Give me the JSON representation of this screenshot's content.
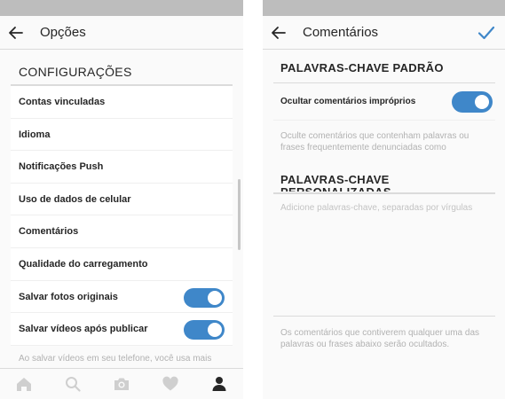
{
  "colors": {
    "accent": "#3f87c9",
    "status_bar": "#bdbdbd",
    "muted_text": "#b2b2b2"
  },
  "left_screen": {
    "title": "Opções",
    "section_header": "CONFIGURAÇÕES",
    "menu_items": [
      {
        "label": "Contas vinculadas",
        "toggle": false
      },
      {
        "label": "Idioma",
        "toggle": false
      },
      {
        "label": "Notificações Push",
        "toggle": false
      },
      {
        "label": "Uso de dados de celular",
        "toggle": false
      },
      {
        "label": "Comentários",
        "toggle": false
      },
      {
        "label": "Qualidade do carregamento",
        "toggle": false
      },
      {
        "label": "Salvar fotos originais",
        "toggle": true,
        "on": true
      },
      {
        "label": "Salvar vídeos após publicar",
        "toggle": true,
        "on": true
      }
    ],
    "footnote": "Ao salvar vídeos em seu telefone, você usa mais",
    "tabbar": [
      "home-icon",
      "search-icon",
      "camera-icon",
      "heart-icon",
      "profile-icon"
    ],
    "active_tab": "profile-icon"
  },
  "right_screen": {
    "title": "Comentários",
    "default_keywords_header": "PALAVRAS-CHAVE PADRÃO",
    "hide_toggle_label": "Ocultar comentários impróprios",
    "hide_toggle_on": true,
    "hide_description": "Oculte comentários que contenham palavras ou frases frequentemente denunciadas como",
    "custom_keywords_header": "PALAVRAS-CHAVE PERSONALIZADAS",
    "keywords_placeholder": "Adicione palavras-chave, separadas por vírgulas",
    "custom_description": "Os comentários que contiverem qualquer uma das palavras ou frases abaixo serão ocultados."
  }
}
